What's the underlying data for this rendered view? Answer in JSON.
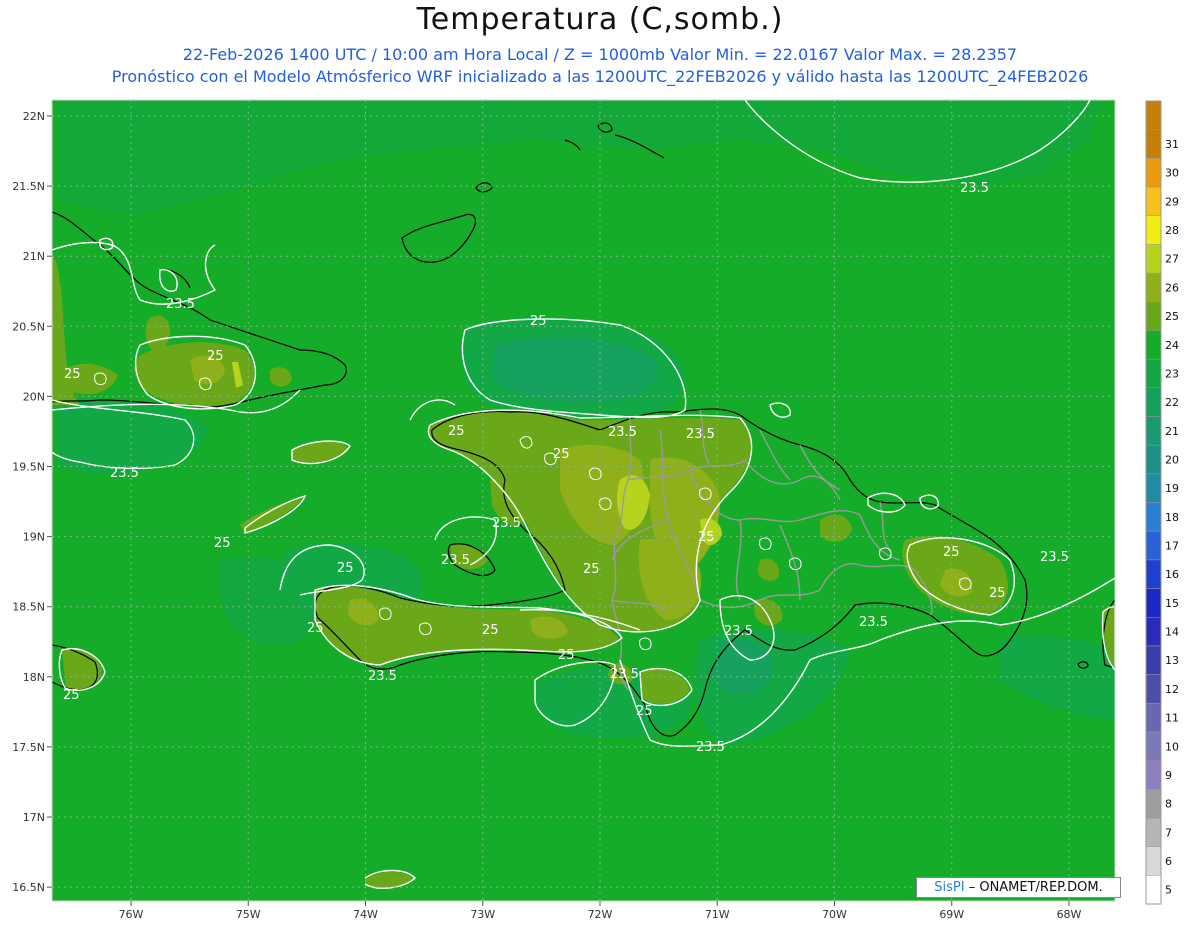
{
  "header": {
    "title": "Temperatura (C,somb.)",
    "subtitle_1": "22-Feb-2026 1400 UTC / 10:00 am Hora Local / Z = 1000mb  Valor Min. = 22.0167  Valor Max. = 28.2357",
    "subtitle_2": "Pronóstico con el Modelo Atmósferico WRF inicializado a las 1200UTC_22FEB2026 y válido hasta las  1200UTC_24FEB2026"
  },
  "axes": {
    "lat_labels": [
      "22N",
      "21.5N",
      "21N",
      "20.5N",
      "20N",
      "19.5N",
      "19N",
      "18.5N",
      "18N",
      "17.5N",
      "17N",
      "16.5N"
    ],
    "lon_labels": [
      "76W",
      "75W",
      "74W",
      "73W",
      "72W",
      "71W",
      "70W",
      "69W",
      "68W"
    ],
    "lat_values": [
      22,
      21.5,
      21,
      20.5,
      20,
      19.5,
      19,
      18.5,
      18,
      17.5,
      17,
      16.5
    ],
    "lon_values": [
      -76,
      -75,
      -74,
      -73,
      -72,
      -71,
      -70,
      -69,
      -68
    ]
  },
  "colorbar": {
    "levels": [
      "5",
      "6",
      "7",
      "8",
      "9",
      "10",
      "11",
      "12",
      "13",
      "14",
      "15",
      "16",
      "17",
      "18",
      "19",
      "20",
      "21",
      "22",
      "23",
      "24",
      "25",
      "26",
      "27",
      "28",
      "29",
      "30",
      "31"
    ],
    "colors": [
      "#ffffff",
      "#d9d9d9",
      "#b5b5b5",
      "#9e9e9e",
      "#8e7fbf",
      "#7b78b8",
      "#6a67b2",
      "#4c4fa8",
      "#3c3dad",
      "#2a2bb8",
      "#1d27c2",
      "#1f3fcf",
      "#2a62d6",
      "#2a7fd2",
      "#238aa6",
      "#1c8f88",
      "#1a9a72",
      "#16a05c",
      "#12a845",
      "#14ac28",
      "#6aa81a",
      "#8fb01a",
      "#b6d41e",
      "#eeee10",
      "#f6c11a",
      "#e99b0e",
      "#c57e08"
    ],
    "top_color": "#c57e08"
  },
  "field": {
    "background_color": "#14ac28",
    "contour_levels": [
      "23.5",
      "25"
    ]
  },
  "contour_labels": {
    "ne_ocean": "23.5",
    "cuba_east": "23.5",
    "cuba_25": "25",
    "cuba_west_25": "25",
    "windward": "23.5",
    "windward_patch": "25",
    "haiti_north": "25",
    "haiti_center": "25",
    "haiti_235": "23.5",
    "haiti_north_235": "23.5",
    "dr_center": "25",
    "gonave": "23.5",
    "gonaives_25": "25",
    "tiburon_235": "23.5",
    "tiburon_25": "25",
    "tiburon_25b": "25",
    "tiburon_25c": "25",
    "tiburon_south": "25",
    "south_coast": "23.5",
    "dr_south": "23.5",
    "dr_east": "25",
    "dr_east2": "25",
    "east_sea": "23.5",
    "dr_se": "23.5",
    "barahona": "23.5",
    "pedernales": "25",
    "south_sea": "23.5",
    "jamaica": "25",
    "west_stripe": "25"
  },
  "credit": {
    "brand": "SisPI",
    "org": "– ONAMET/REP.DOM."
  }
}
